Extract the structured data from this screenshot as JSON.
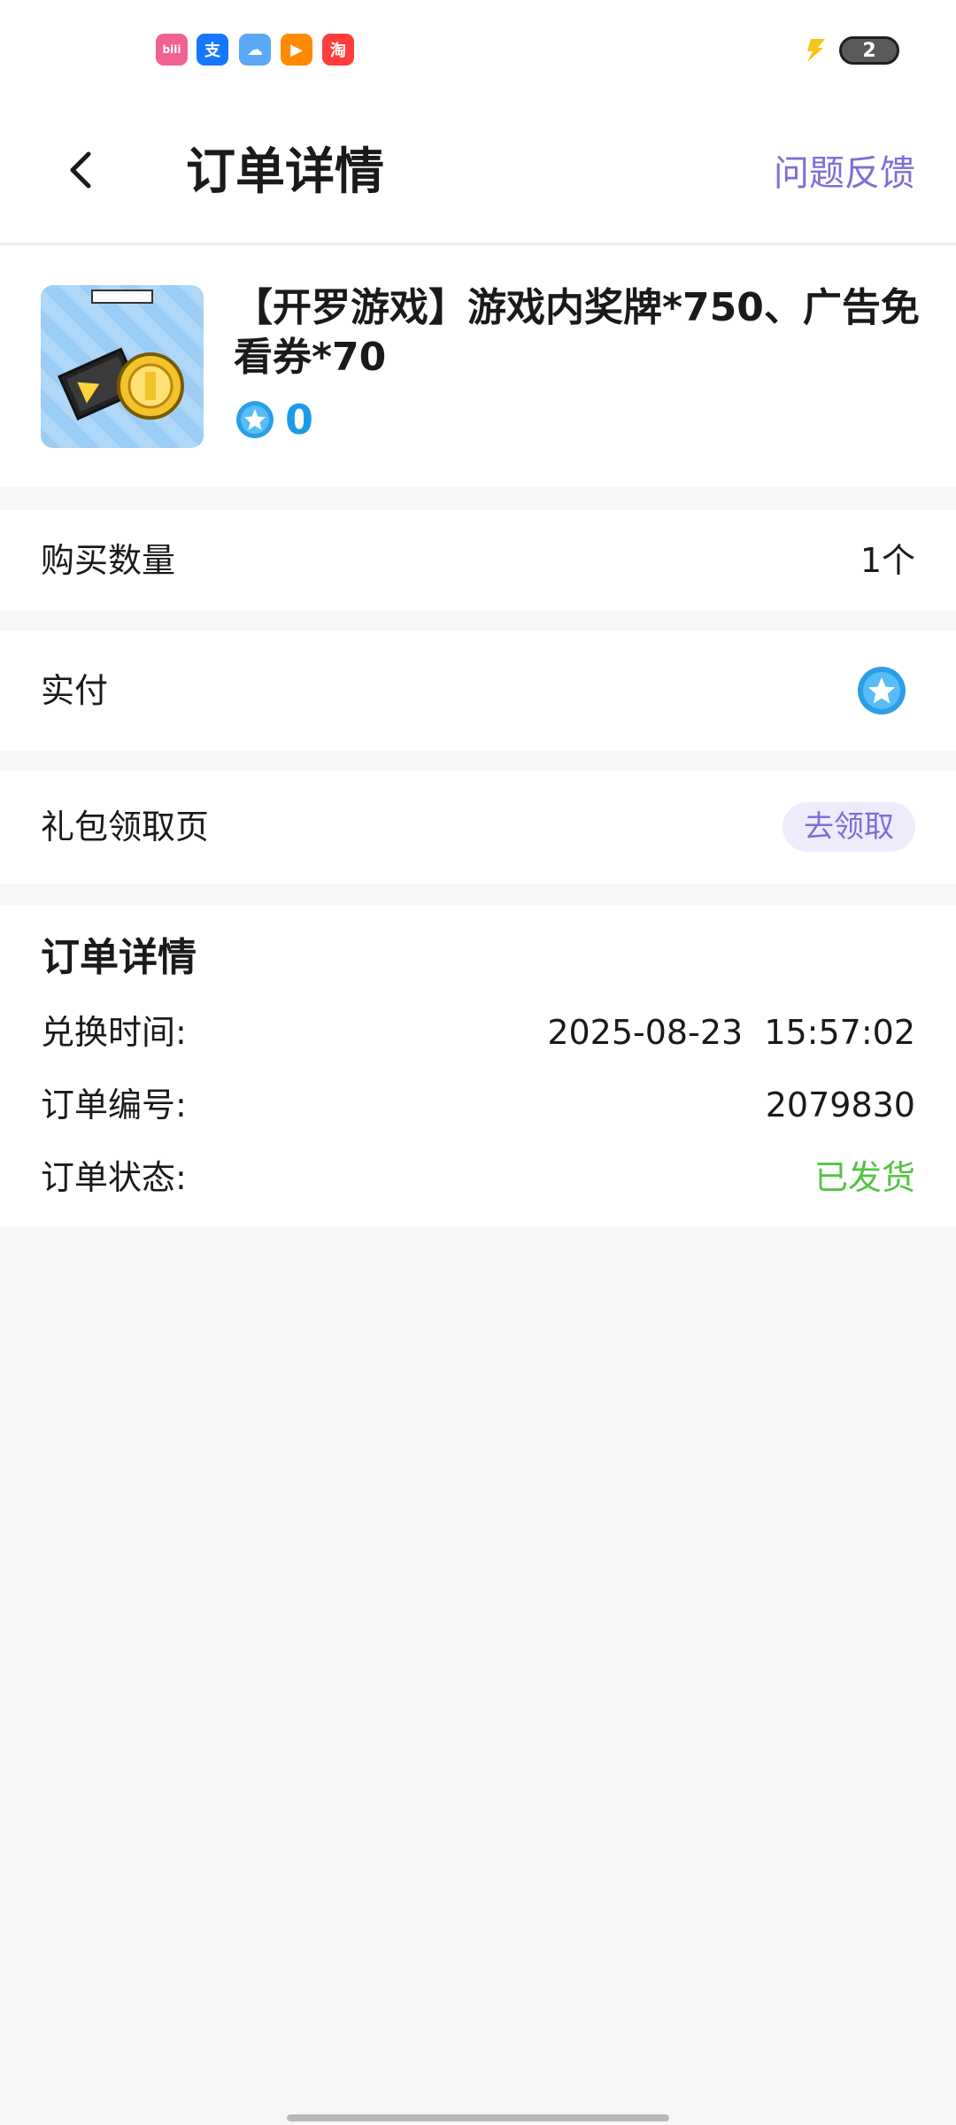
{
  "status_bar": {
    "app_icons": [
      "bilibili-icon",
      "alipay-icon",
      "weather-icon",
      "video-icon",
      "taobao-icon"
    ],
    "icon_glyphs": [
      "bili",
      "支",
      "☁",
      "▶",
      "淘"
    ],
    "battery_level": "2"
  },
  "header": {
    "title": "订单详情",
    "feedback_label": "问题反馈"
  },
  "product": {
    "title": "【开罗游戏】游戏内奖牌*750、广告免看券*70",
    "price": "0"
  },
  "rows": {
    "quantity_label": "购买数量",
    "quantity_value": "1个",
    "paid_label": "实付",
    "gift_label": "礼包领取页",
    "claim_button": "去领取"
  },
  "order_details": {
    "title": "订单详情",
    "redeem_time_label": "兑换时间:",
    "redeem_time_value": "2025-08-23  15:57:02",
    "order_number_label": "订单编号:",
    "order_number_value": "2079830",
    "order_status_label": "订单状态:",
    "order_status_value": "已发货"
  },
  "colors": {
    "accent": "#7c6fd6",
    "price": "#1e9be6",
    "status_shipped": "#52c441",
    "background": "#f6f7f9"
  }
}
